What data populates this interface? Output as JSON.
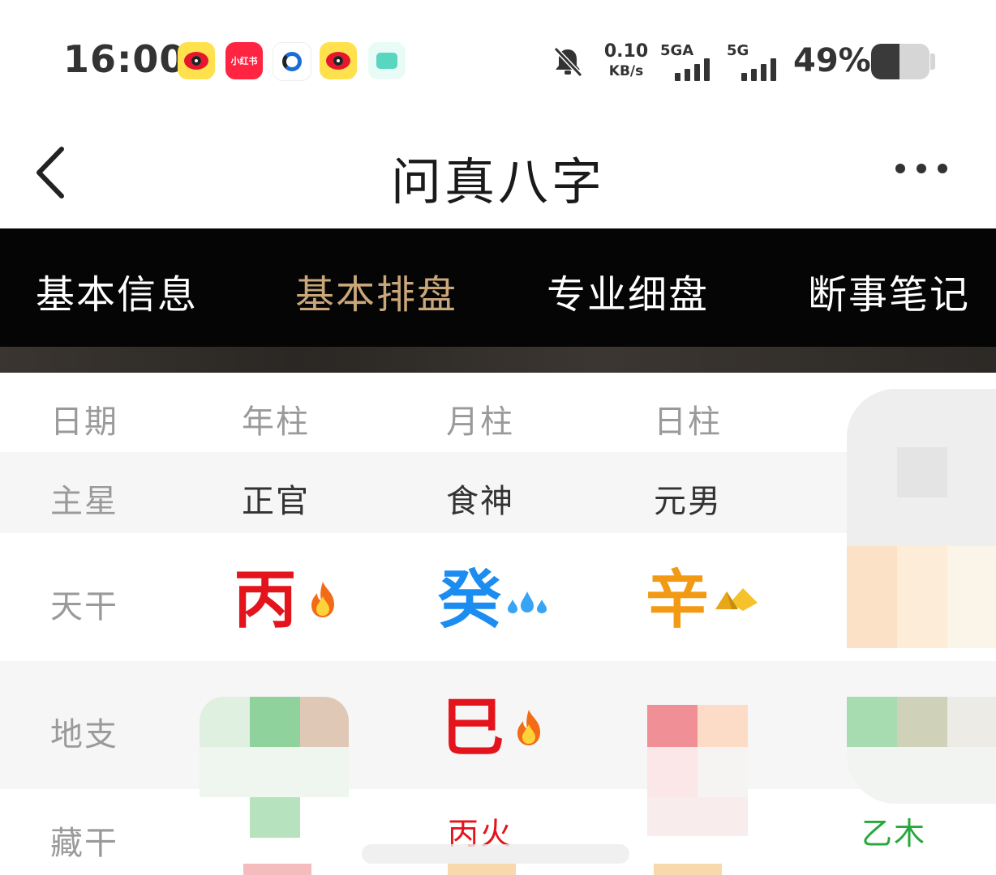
{
  "status_bar": {
    "time": "16:00",
    "xiaohongshu_label": "小红书",
    "net_speed_value": "0.10",
    "net_speed_unit": "KB/s",
    "sim1_label": "5GA",
    "sim2_label": "5G",
    "battery_percent": "49%",
    "battery_level": 0.49,
    "icons": [
      "weibo-icon",
      "xiaohongshu-icon",
      "baidu-icon",
      "weibo-icon",
      "chat-icon",
      "mute-icon",
      "signal-icon",
      "signal-icon",
      "battery-icon"
    ]
  },
  "nav": {
    "title": "问真八字",
    "back_icon": "chevron-left-icon",
    "more_icon": "more-dots-icon"
  },
  "tabs": [
    {
      "label": "基本信息",
      "active": false
    },
    {
      "label": "基本排盘",
      "active": true
    },
    {
      "label": "专业细盘",
      "active": false
    },
    {
      "label": "断事笔记",
      "active": false
    }
  ],
  "colors": {
    "tab_active": "#c9a77b",
    "fire_red": "#e3141b",
    "water_blue": "#1b8cf0",
    "metal_orange": "#f39a14",
    "wood_green": "#27a83a"
  },
  "table": {
    "header": {
      "label": "日期",
      "columns": [
        "年柱",
        "月柱",
        "日柱"
      ]
    },
    "main_star": {
      "label": "主星",
      "values": [
        "正官",
        "食神",
        "元男"
      ]
    },
    "heavenly_stem": {
      "label": "天干",
      "values": [
        {
          "char": "丙",
          "icon": "fire-icon"
        },
        {
          "char": "癸",
          "icon": "water-drops-icon"
        },
        {
          "char": "辛",
          "icon": "gold-ingot-icon"
        }
      ]
    },
    "earthly_branch": {
      "label": "地支",
      "values": [
        {
          "char": "巳",
          "icon": "fire-icon"
        }
      ]
    },
    "hidden_stem": {
      "label": "藏干",
      "values": [
        "丙火",
        "乙木"
      ]
    }
  }
}
